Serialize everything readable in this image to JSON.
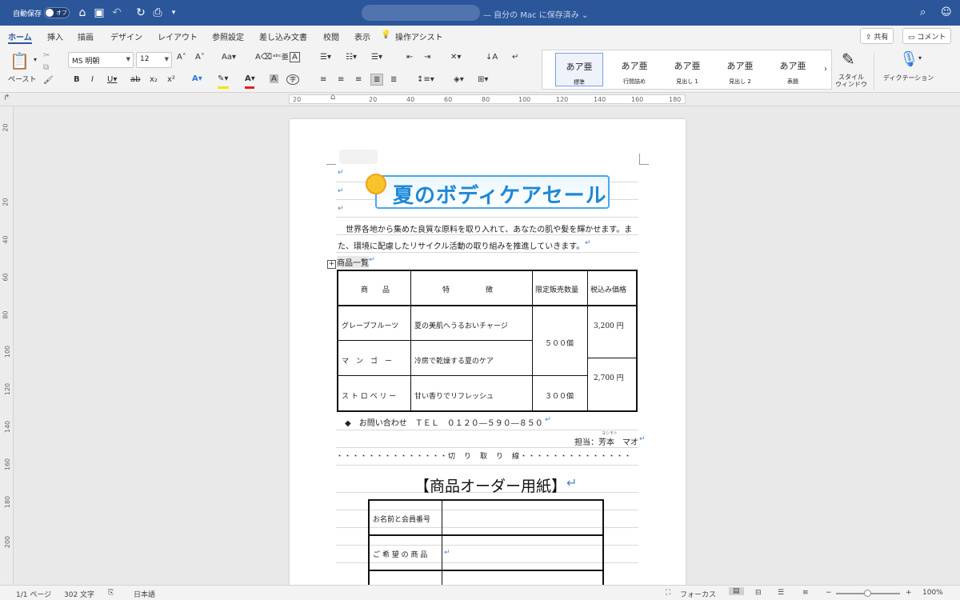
{
  "titlebar": {
    "autosave_label": "自動保存",
    "autosave_state": "オフ",
    "title": "— 自分の Mac に保存済み ⌄"
  },
  "tabs": [
    "ホーム",
    "挿入",
    "描画",
    "デザイン",
    "レイアウト",
    "参照設定",
    "差し込み文書",
    "校閲",
    "表示"
  ],
  "tell_me": "操作アシスト",
  "share_label": "共有",
  "comment_label": "コメント",
  "ribbon": {
    "paste_label": "ペースト",
    "font_name": "MS 明朝",
    "font_size": "12",
    "styles": [
      {
        "sample": "あア亜",
        "name": "標準",
        "selected": true
      },
      {
        "sample": "あア亜",
        "name": "行間詰め",
        "selected": false
      },
      {
        "sample": "あア亜",
        "name": "見出し 1",
        "selected": false
      },
      {
        "sample": "あア亜",
        "name": "見出し 2",
        "selected": false
      },
      {
        "sample": "あア亜",
        "name": "表題",
        "selected": false
      }
    ],
    "style_window_label": "スタイル\nウィンドウ",
    "dictation_label": "ディクテーション"
  },
  "ruler": {
    "h_numbers": [
      "20",
      "20",
      "40",
      "60",
      "80",
      "100",
      "120",
      "140",
      "160",
      "180"
    ],
    "v_numbers": [
      "20",
      "20",
      "40",
      "60",
      "80",
      "100",
      "120",
      "140",
      "160",
      "180",
      "200"
    ]
  },
  "document": {
    "banner_title": "夏のボディケアセール",
    "intro_line1": "世界各地から集めた良質な原料を取り入れて、あなたの肌や髪を輝かせます。ま",
    "intro_line2": "た、環境に配慮したリサイクル活動の取り組みを推進していきます。",
    "list_label": "商品一覧",
    "table": {
      "headers": [
        "商　　品",
        "特　　　　　徴",
        "限定販売数量",
        "税込み価格"
      ],
      "rows": [
        {
          "product": "グレープフルーツ",
          "feature": "夏の美肌へうるおいチャージ"
        },
        {
          "product": "マ　ン　ゴ　ー",
          "feature": "冷房で乾燥する夏のケア"
        },
        {
          "product": "ス ト ロ ベ リ ー",
          "feature": "甘い香りでリフレッシュ"
        }
      ],
      "qty_1": "５００個",
      "qty_2": "３００個",
      "price_1": "3,200 円",
      "price_2": "2,700 円"
    },
    "contact": "◆　お問い合わせ　ＴＥＬ　０１２０―５９０―８５０",
    "person": "担当：芳本　マオ",
    "ruby": "ヨシモト",
    "cut_line": "・・・・・・・・・・・・・・切　り　取　り　線・・・・・・・・・・・・・・",
    "order_title": "【商品オーダー用紙】",
    "order_rows": [
      "お名前と会員番号",
      "ご 希 望 の 商 品"
    ]
  },
  "status": {
    "page": "1/1 ページ",
    "words": "302 文字",
    "language": "日本語",
    "focus": "フォーカス",
    "zoom": "100%",
    "zoom_level": 0.5
  }
}
